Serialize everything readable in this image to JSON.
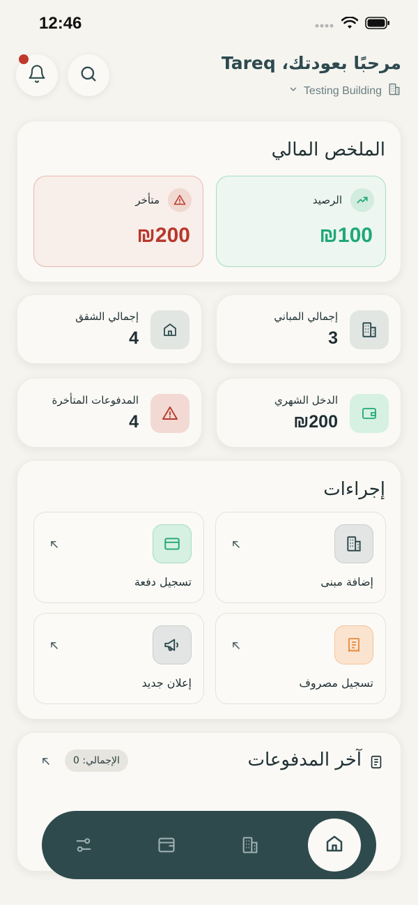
{
  "status": {
    "time": "12:46"
  },
  "header": {
    "greeting": "مرحبًا بعودتك، Tareq",
    "building_name": "Testing Building"
  },
  "financial_summary": {
    "title": "الملخص المالي",
    "balance_label": "الرصيد",
    "balance_value": "₪100",
    "overdue_label": "متأخر",
    "overdue_value": "₪200"
  },
  "stats": [
    {
      "label": "إجمالي المباني",
      "value": "3",
      "icon": "building-icon"
    },
    {
      "label": "إجمالي الشقق",
      "value": "4",
      "icon": "home-icon"
    },
    {
      "label": "الدخل الشهري",
      "value": "₪200",
      "icon": "wallet-icon"
    },
    {
      "label": "المدفوعات المتأخرة",
      "value": "4",
      "icon": "warning-icon"
    }
  ],
  "actions": {
    "title": "إجراءات",
    "items": [
      {
        "label": "إضافة مبنى",
        "icon": "building-icon"
      },
      {
        "label": "تسجيل دفعة",
        "icon": "credit-card-icon"
      },
      {
        "label": "تسجيل مصروف",
        "icon": "receipt-icon"
      },
      {
        "label": "إعلان جديد",
        "icon": "megaphone-icon"
      }
    ]
  },
  "recent_payments": {
    "title": "آخر المدفوعات",
    "total_badge": "الإجمالي: 0"
  },
  "nav": {
    "items": [
      "home-icon",
      "building-icon",
      "wallet-icon",
      "settings-sliders-icon"
    ],
    "active": "home-icon"
  },
  "colors": {
    "accent_green": "#1fa878",
    "danger_red": "#b7382c",
    "nav_dark": "#2e4a4d",
    "background": "#f5f4ef"
  }
}
